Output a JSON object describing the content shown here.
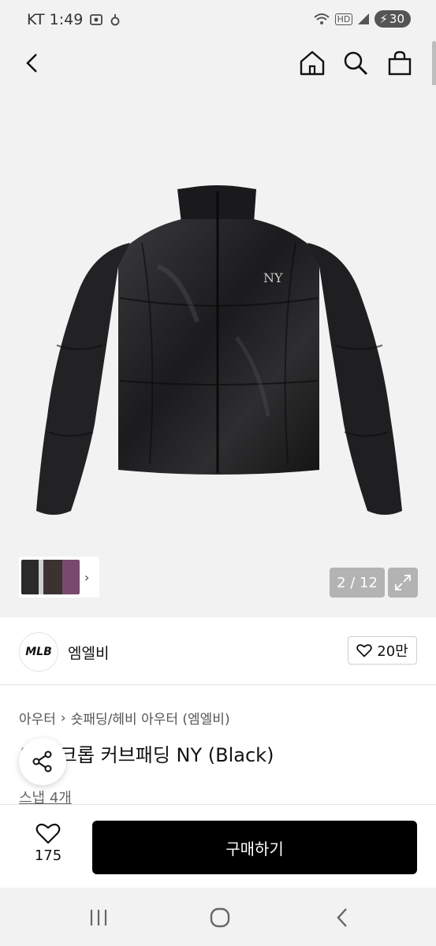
{
  "status_bar": {
    "carrier_time": "KT 1:49",
    "battery": "30",
    "network": "HD"
  },
  "product": {
    "image_counter": "2 / 12",
    "brand_logo_text": "MLB",
    "brand_name": "엠엘비",
    "brand_likes": "20만",
    "breadcrumb": [
      "아우터",
      "숏패딩/헤비 아우터 (엠엘비)"
    ],
    "title": "우먼 크롭 커브패딩 NY (Black)",
    "snap_link": "스냅 4개"
  },
  "bottom_bar": {
    "wish_count": "175",
    "buy_label": "구매하기"
  },
  "icons": {
    "back": "back-arrow-icon",
    "home": "home-icon",
    "search": "search-icon",
    "cart": "shopping-bag-icon",
    "expand": "expand-icon",
    "share": "share-icon",
    "heart": "heart-icon"
  },
  "colors": {
    "buy_button": "#000000",
    "background": "#f2f2f2",
    "counter_bg": "#b3b3b3"
  }
}
